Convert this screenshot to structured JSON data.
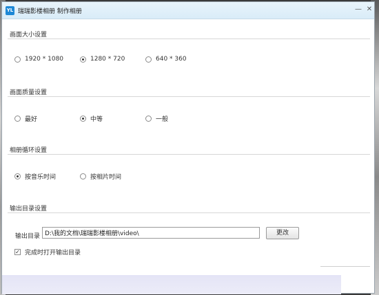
{
  "window": {
    "icon_text": "YL",
    "title": "瑞瑞影楼相册 制作相册",
    "minimize_glyph": "—",
    "close_glyph": "✕"
  },
  "sections": {
    "size": {
      "heading": "画面大小设置",
      "options": [
        {
          "label": "1920 * 1080",
          "selected": false
        },
        {
          "label": "1280 * 720",
          "selected": true
        },
        {
          "label": "640 * 360",
          "selected": false
        }
      ]
    },
    "quality": {
      "heading": "画面质量设置",
      "options": [
        {
          "label": "最好",
          "selected": false
        },
        {
          "label": "中等",
          "selected": true
        },
        {
          "label": "一般",
          "selected": false
        }
      ]
    },
    "loop": {
      "heading": "相册循环设置",
      "options": [
        {
          "label": "按音乐时间",
          "selected": true
        },
        {
          "label": "按相片时间",
          "selected": false
        }
      ]
    },
    "output": {
      "heading": "输出目录设置",
      "dir_label": "输出目录",
      "dir_value": "D:\\我的文档\\瑞瑞影楼相册\\video\\",
      "change_button": "更改",
      "open_on_finish_label": "完成时打开输出目录",
      "open_on_finish_checked": true
    }
  }
}
